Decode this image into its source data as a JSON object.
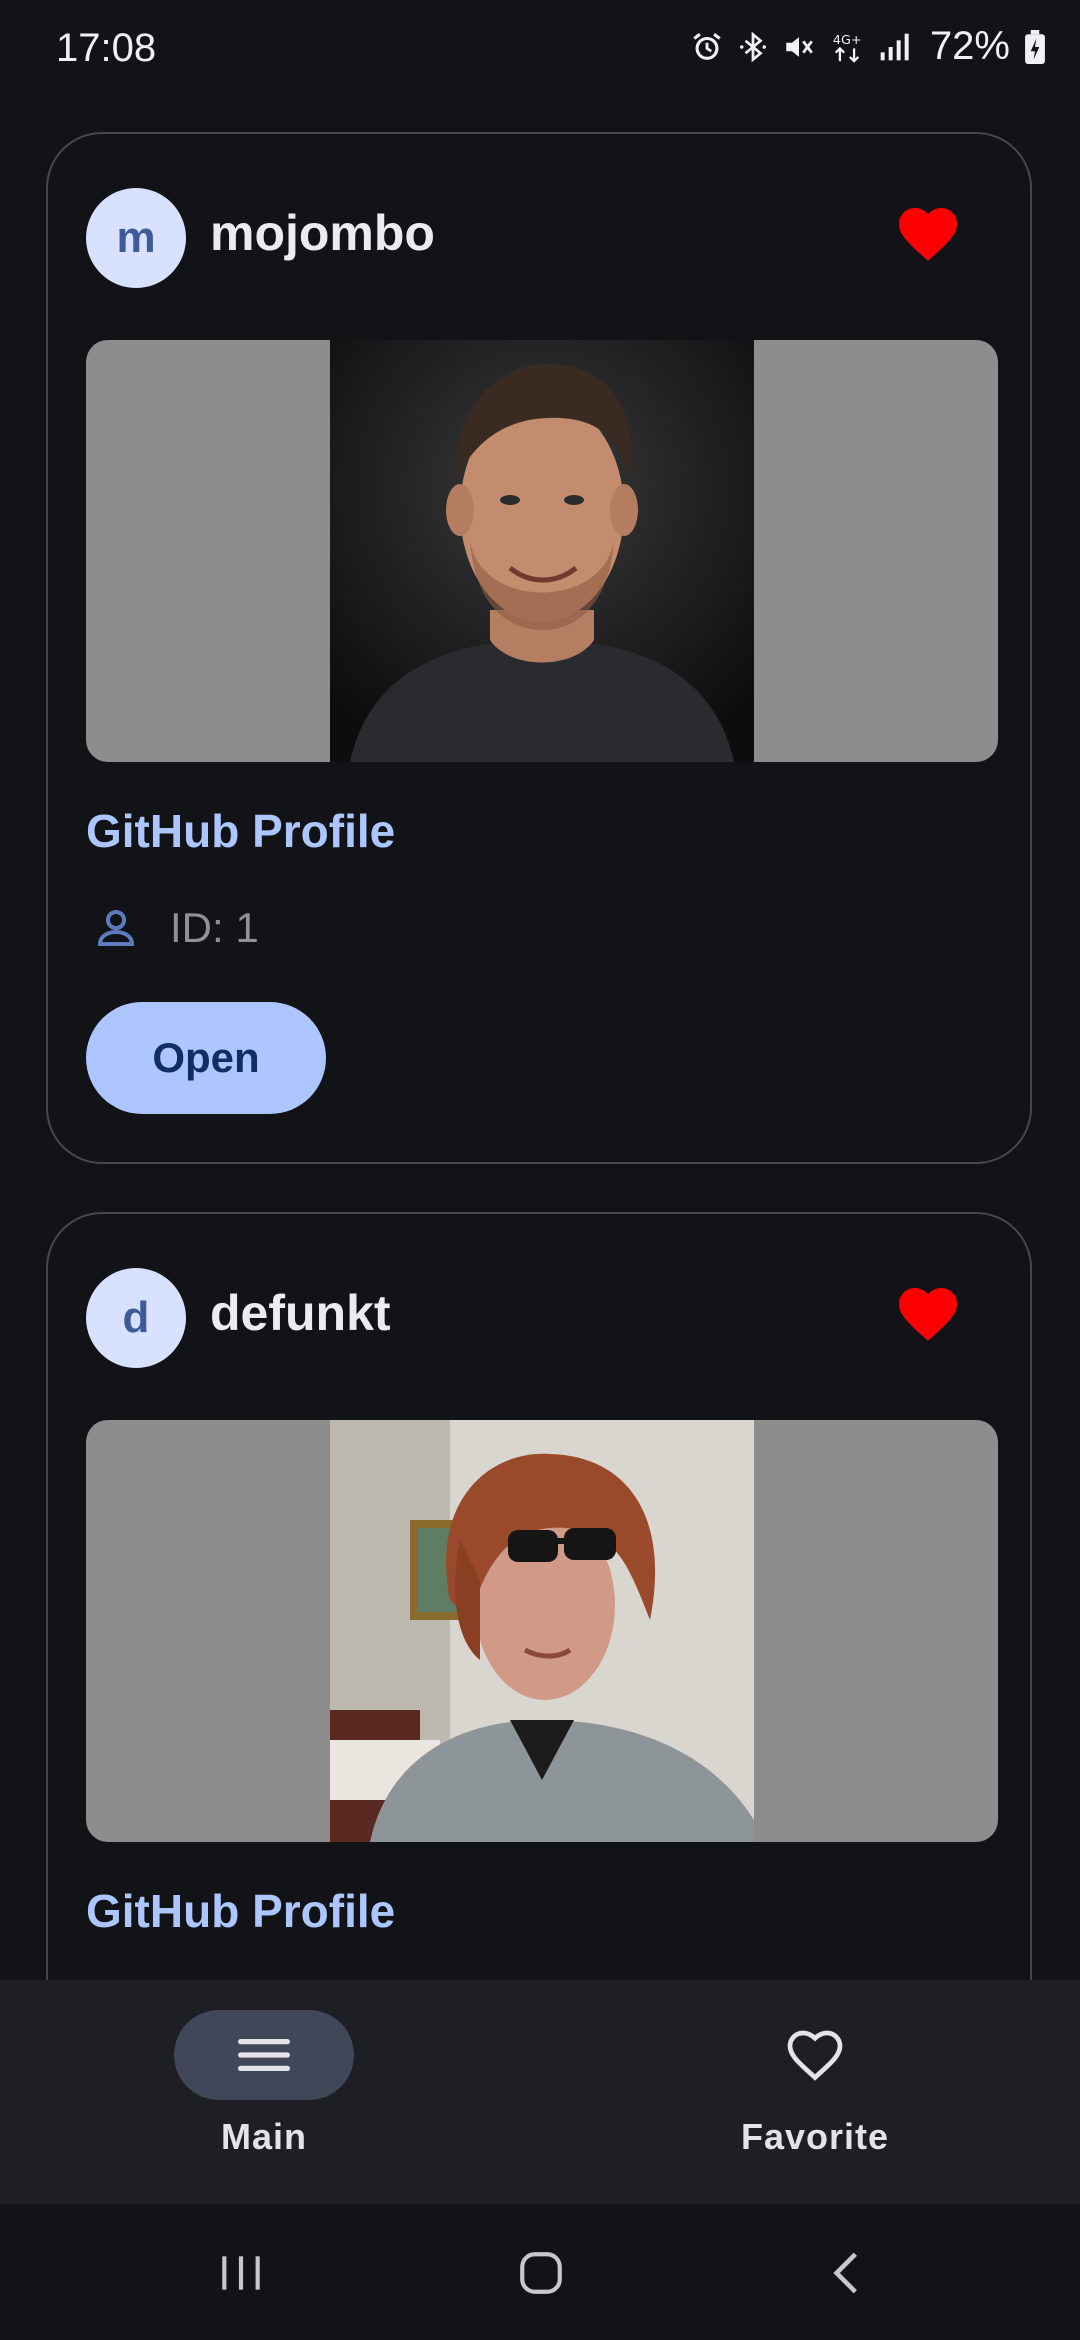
{
  "status": {
    "time": "17:08",
    "battery": "72%",
    "icons": [
      "alarm-icon",
      "bluetooth-icon",
      "mute-icon",
      "4g-plus-icon",
      "signal-icon",
      "battery-charging-icon"
    ]
  },
  "cards": [
    {
      "avatar_letter": "m",
      "username": "mojombo",
      "favorite": true,
      "link_label": "GitHub Profile",
      "id_text": "ID: 1",
      "open_label": "Open"
    },
    {
      "avatar_letter": "d",
      "username": "defunkt",
      "favorite": true,
      "link_label": "GitHub Profile"
    }
  ],
  "nav": {
    "main_label": "Main",
    "favorite_label": "Favorite",
    "active": "Main"
  },
  "colors": {
    "background": "#121317",
    "accent": "#adc6ff",
    "heart": "#ff0000",
    "avatar_bg": "#d8e2ff",
    "nav_bg": "#1e1f25"
  }
}
